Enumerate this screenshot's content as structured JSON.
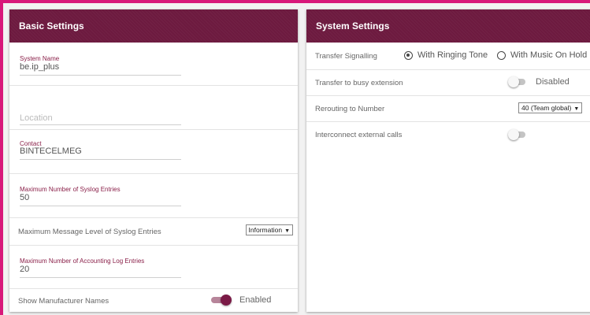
{
  "basic": {
    "title": "Basic Settings",
    "system_name": {
      "label": "System Name",
      "value": "be.ip_plus"
    },
    "location": {
      "placeholder": "Location"
    },
    "contact": {
      "label": "Contact",
      "value": "BINTECELMEG"
    },
    "max_syslog": {
      "label": "Maximum Number of Syslog Entries",
      "value": "50"
    },
    "syslog_level": {
      "label": "Maximum Message Level of Syslog Entries",
      "selected": "Information"
    },
    "max_accounting": {
      "label": "Maximum Number of Accounting Log Entries",
      "value": "20"
    },
    "manufacturer_names": {
      "label": "Show Manufacturer Names",
      "state": "Enabled"
    }
  },
  "system": {
    "title": "System Settings",
    "transfer_signalling": {
      "label": "Transfer Signalling",
      "options": [
        "With Ringing Tone",
        "With Music On Hold"
      ],
      "selected": "With Ringing Tone"
    },
    "transfer_busy": {
      "label": "Transfer to busy extension",
      "state": "Disabled"
    },
    "rerouting": {
      "label": "Rerouting to Number",
      "selected": "40 (Team global)"
    },
    "interconnect": {
      "label": "Interconnect external calls"
    }
  },
  "colors": {
    "accent_border": "#d8187a",
    "header_bg": "#6d1a3f",
    "label_color": "#8a2049",
    "toggle_on": "#7a1a46"
  }
}
